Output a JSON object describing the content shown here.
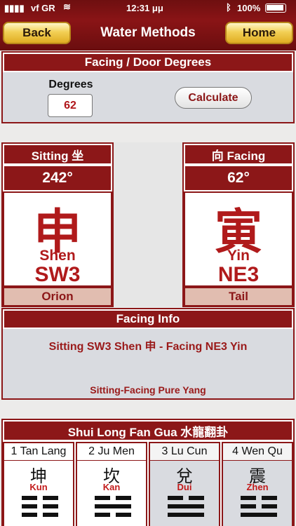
{
  "status_bar": {
    "carrier": "vf GR",
    "time": "12:31 μμ",
    "battery": "100%"
  },
  "nav": {
    "back_label": "Back",
    "title": "Water Methods",
    "home_label": "Home"
  },
  "degrees_panel": {
    "header": "Facing / Door Degrees",
    "label": "Degrees",
    "value": "62",
    "calculate_label": "Calculate"
  },
  "sitting": {
    "title": "Sitting 坐",
    "degrees": "242°",
    "char": "申",
    "pinyin": "Shen",
    "mountain": "SW3",
    "star": "Orion"
  },
  "facing": {
    "title": "向 Facing",
    "degrees": "62°",
    "char": "寅",
    "pinyin": "Yin",
    "mountain": "NE3",
    "star": "Tail"
  },
  "info": {
    "header": "Facing Info",
    "line1": "Sitting SW3 Shen 申  -  Facing NE3 Yin",
    "line2": "Sitting-Facing Pure Yang"
  },
  "gua": {
    "header": "Shui Long Fan Gua 水龍翻卦",
    "tabs": [
      "1 Tan Lang",
      "2 Ju Men",
      "3 Lu Cun",
      "4 Wen Qu"
    ],
    "cells": [
      {
        "char": "坤",
        "name": "Kun"
      },
      {
        "char": "坎",
        "name": "Kan"
      },
      {
        "char": "兌",
        "name": "Dui"
      },
      {
        "char": "震",
        "name": "Zhen"
      }
    ]
  },
  "colors": {
    "primary": "#8c1718",
    "accent_red": "#b01a1b",
    "gold": "#f2cf55",
    "panel_grey": "#d9dbe0"
  }
}
